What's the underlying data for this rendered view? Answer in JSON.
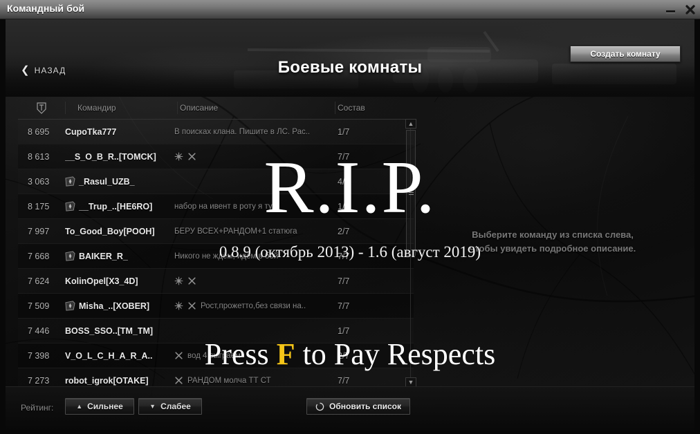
{
  "window": {
    "title": "Командный бой",
    "minimize_icon": "minimize-icon",
    "close_icon": "close-icon"
  },
  "header": {
    "back_label": "НАЗАД",
    "back_icon": "chevron-left-icon",
    "page_title": "Боевые комнаты",
    "create_room_label": "Создать комнату"
  },
  "table": {
    "columns": {
      "rating_icon": "shield-rating-icon",
      "commander": "Командир",
      "description": "Описание",
      "composition": "Состав"
    },
    "rows": [
      {
        "rating": "8 695",
        "emblem": false,
        "commander": "CupoTka777",
        "tags": [],
        "description": "В поисках клана. Пишите в ЛС. Рас..",
        "composition": "1/7"
      },
      {
        "rating": "8 613",
        "emblem": false,
        "commander": "__S_O_B_R..[TOMCK]",
        "tags": [
          "snowflake-icon",
          "x-icon"
        ],
        "description": "",
        "composition": "7/7"
      },
      {
        "rating": "3 063",
        "emblem": true,
        "commander": "_Rasul_UZB_",
        "tags": [],
        "description": "",
        "composition": "4/7"
      },
      {
        "rating": "8 175",
        "emblem": true,
        "commander": "__Trup_..[HE6RO]",
        "tags": [],
        "description": "набор на ивент в роту я ту..",
        "composition": "1/7"
      },
      {
        "rating": "7 997",
        "emblem": false,
        "commander": "To_Good_Boy[POOH]",
        "tags": [],
        "description": "БЕРУ ВСЕХ+РАНДОМ+1 статюга",
        "composition": "2/7"
      },
      {
        "rating": "7 668",
        "emblem": true,
        "commander": "BAIKER_R_",
        "tags": [],
        "description": "Никого не ждём, идём в бой",
        "composition": "7/7"
      },
      {
        "rating": "7 624",
        "emblem": false,
        "commander": "KolinOpel[X3_4D]",
        "tags": [
          "snowflake-icon",
          "x-icon"
        ],
        "description": "",
        "composition": "7/7"
      },
      {
        "rating": "7 509",
        "emblem": true,
        "commander": "Misha_..[XOBER]",
        "tags": [
          "snowflake-icon",
          "x-icon"
        ],
        "description": "Рост,прожетто,без связи на..",
        "composition": "7/7"
      },
      {
        "rating": "7 446",
        "emblem": false,
        "commander": "BOSS_SSO..[TM_TM]",
        "tags": [],
        "description": "",
        "composition": "1/7"
      },
      {
        "rating": "7 398",
        "emblem": false,
        "commander": "V_O_L_C_H_A_R_A..",
        "tags": [
          "x-icon"
        ],
        "description": "вод 4 сыграем",
        "composition": "2/7"
      },
      {
        "rating": "7 273",
        "emblem": false,
        "commander": "robot_igrok[OTAKE]",
        "tags": [
          "x-icon"
        ],
        "description": "РАНДОМ молча ТТ СТ",
        "composition": "7/7"
      }
    ]
  },
  "scrollbar": {
    "up_icon": "chevron-up-icon",
    "down_icon": "chevron-down-icon"
  },
  "detail": {
    "hint_line_1": "Выберите команду из списка слева,",
    "hint_line_2": "чтобы увидеть подробное описание."
  },
  "bottom": {
    "rating_label": "Рейтинг:",
    "stronger_label": "Сильнее",
    "stronger_arrow": "▲",
    "weaker_label": "Слабее",
    "weaker_arrow": "▼",
    "refresh_label": "Обновить список",
    "refresh_icon": "refresh-circle-icon"
  },
  "overlay": {
    "rip": "R.I.P.",
    "version_range": "0.8.9 (октябрь 2013) - 1.6 (август 2019)",
    "press_prefix": "Press ",
    "press_key": "F",
    "press_suffix": " to Pay Respects",
    "key_color": "#f5c518"
  }
}
